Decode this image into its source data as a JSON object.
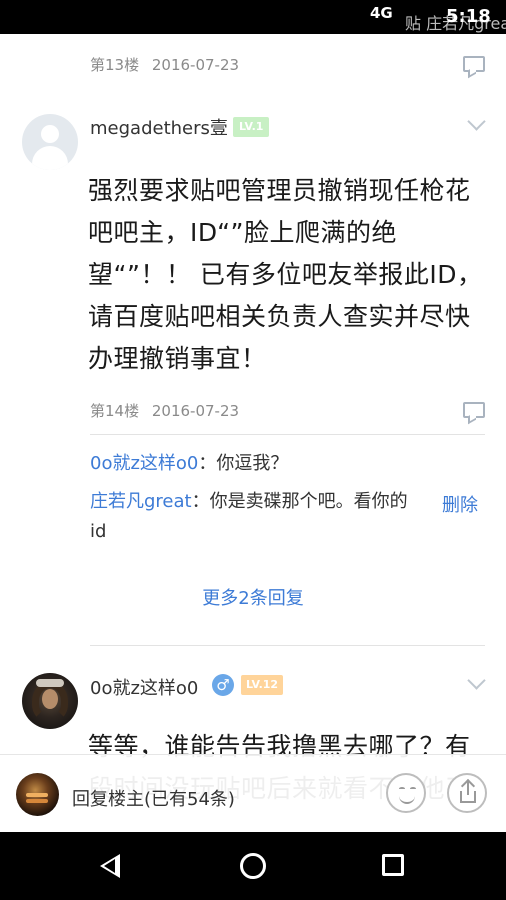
{
  "status_bar": {
    "network": "4G",
    "watermark": "贴 庄若凡great",
    "time": "5:18"
  },
  "floors": {
    "f13": {
      "floor": "第13楼",
      "date": "2016-07-23"
    },
    "f14": {
      "author": "megadethers壹",
      "level": "LV.1",
      "text": "强烈要求贴吧管理员撤销现任枪花吧吧主，ID“”脸上爬满的绝望“”！！ 已有多位吧友举报此ID，请百度贴吧相关负责人查实并尽快办理撤销事宜！",
      "floor": "第14楼",
      "date": "2016-07-23",
      "replies": [
        {
          "name": "0o就z这样o0",
          "sep": "：",
          "text": "你逗我？"
        },
        {
          "name": "庄若凡great",
          "sep": "：",
          "text": "你是卖碟那个吧。看你的id"
        }
      ],
      "delete_label": "删除",
      "more_replies": "更多2条回复"
    },
    "f15": {
      "author": "0o就z这样o0",
      "gender": "♂",
      "level": "LV.12",
      "text": "等等，谁能告告我撸黑去哪了？有段时间没玩贴吧后来就看不到他了"
    }
  },
  "reply_bar": {
    "label": "回复楼主(已有54条)"
  }
}
